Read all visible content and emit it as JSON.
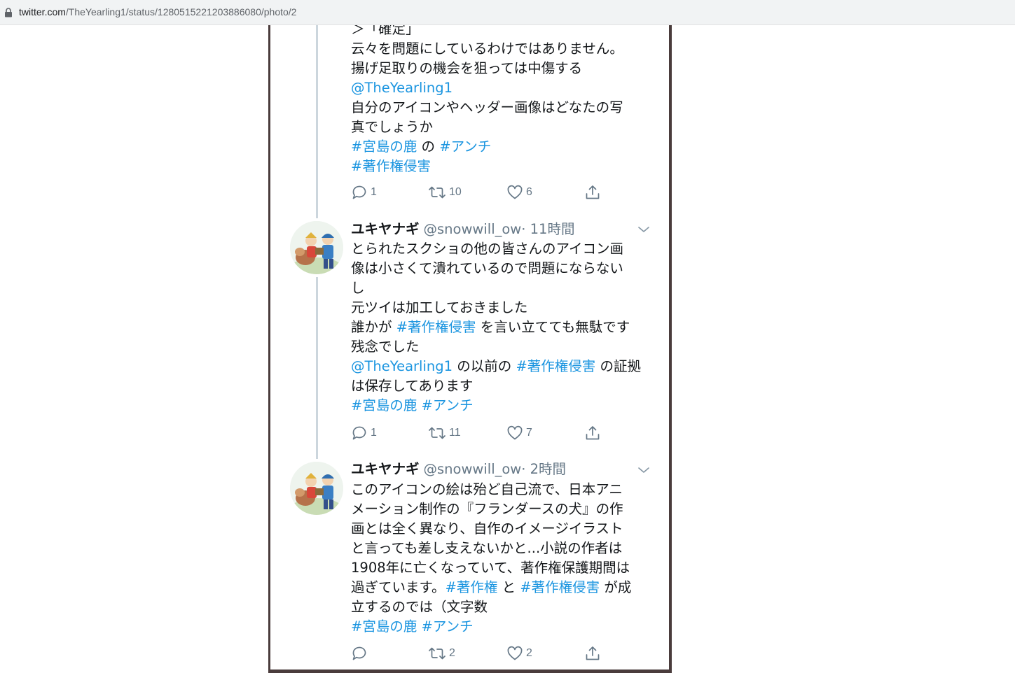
{
  "browser": {
    "url_host": "twitter.com",
    "url_path": "/TheYearling1/status/1280515221203886080/photo/2"
  },
  "tweet1": {
    "lines": [
      [
        {
          "t": "＞「確定」",
          "link": false
        }
      ],
      [
        {
          "t": "云々を問題にしているわけではありません。",
          "link": false
        }
      ],
      [
        {
          "t": "揚げ足取りの機会を狙っては中傷する",
          "link": false
        }
      ],
      [
        {
          "t": "@TheYearling1",
          "link": true
        }
      ],
      [
        {
          "t": "自分のアイコンやヘッダー画像はどなたの写",
          "link": false
        }
      ],
      [
        {
          "t": "真でしょうか",
          "link": false
        }
      ],
      [
        {
          "t": "#宮島の鹿",
          "link": true
        },
        {
          "t": " の ",
          "link": false
        },
        {
          "t": "#アンチ",
          "link": true
        }
      ],
      [
        {
          "t": "#著作権侵害",
          "link": true
        }
      ]
    ],
    "replies": "1",
    "retweets": "10",
    "likes": "6"
  },
  "tweet2": {
    "author": "ユキヤナギ",
    "handle": "@snowwill_ow",
    "time": "· 11時間",
    "lines": [
      [
        {
          "t": "とられたスクショの他の皆さんのアイコン画",
          "link": false
        }
      ],
      [
        {
          "t": "像は小さくて潰れているので問題にならない",
          "link": false
        }
      ],
      [
        {
          "t": "し",
          "link": false
        }
      ],
      [
        {
          "t": "元ツイは加工しておきました",
          "link": false
        }
      ],
      [
        {
          "t": "誰かが ",
          "link": false
        },
        {
          "t": "#著作権侵害",
          "link": true
        },
        {
          "t": " を言い立てても無駄です",
          "link": false
        }
      ],
      [
        {
          "t": "残念でした",
          "link": false
        }
      ],
      [
        {
          "t": "@TheYearling1",
          "link": true
        },
        {
          "t": " の以前の ",
          "link": false
        },
        {
          "t": "#著作権侵害",
          "link": true
        },
        {
          "t": " の証拠",
          "link": false
        }
      ],
      [
        {
          "t": "は保存してあります",
          "link": false
        }
      ],
      [
        {
          "t": "#宮島の鹿",
          "link": true
        },
        {
          "t": " ",
          "link": false
        },
        {
          "t": "#アンチ",
          "link": true
        }
      ]
    ],
    "replies": "1",
    "retweets": "11",
    "likes": "7"
  },
  "tweet3": {
    "author": "ユキヤナギ",
    "handle": "@snowwill_ow",
    "time": "· 2時間",
    "lines": [
      [
        {
          "t": "このアイコンの絵は殆ど自己流で、日本アニ",
          "link": false
        }
      ],
      [
        {
          "t": "メーション制作の『フランダースの犬』の作",
          "link": false
        }
      ],
      [
        {
          "t": "画とは全く異なり、自作のイメージイラスト",
          "link": false
        }
      ],
      [
        {
          "t": "と言っても差し支えないかと...小説の作者は",
          "link": false
        }
      ],
      [
        {
          "t": "1908年に亡くなっていて、著作権保護期間は",
          "link": false
        }
      ],
      [
        {
          "t": "過ぎています。",
          "link": false
        },
        {
          "t": "#著作権",
          "link": true
        },
        {
          "t": " と ",
          "link": false
        },
        {
          "t": "#著作権侵害",
          "link": true
        },
        {
          "t": " が成",
          "link": false
        }
      ],
      [
        {
          "t": "立するのでは（文字数",
          "link": false
        }
      ],
      [
        {
          "t": "#宮島の鹿",
          "link": true
        },
        {
          "t": " ",
          "link": false
        },
        {
          "t": "#アンチ",
          "link": true
        }
      ]
    ],
    "replies": "",
    "retweets": "2",
    "likes": "2"
  },
  "icons": {
    "lock": "lock-icon",
    "reply": "reply-icon",
    "retweet": "retweet-icon",
    "like": "heart-icon",
    "share": "share-icon",
    "more": "chevron-down-icon"
  },
  "colors": {
    "link": "#1b95e0",
    "text": "#14171a",
    "muted": "#657786",
    "frame": "#4a3c3c"
  }
}
